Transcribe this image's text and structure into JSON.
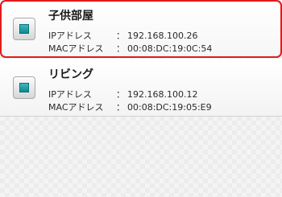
{
  "labels": {
    "ip": "IPアドレス",
    "mac": "MACアドレス",
    "separator": "："
  },
  "devices": [
    {
      "name": "子供部屋",
      "ip": "192.168.100.26",
      "mac": "00:08:DC:19:0C:54",
      "icon": "computer-icon",
      "selected": true
    },
    {
      "name": "リビング",
      "ip": "192.168.100.12",
      "mac": "00:08:DC:19:05:E9",
      "icon": "computer-icon",
      "selected": false
    }
  ],
  "colors": {
    "selection_border": "#e01b1b",
    "icon_screen": "#1a9ea5"
  }
}
